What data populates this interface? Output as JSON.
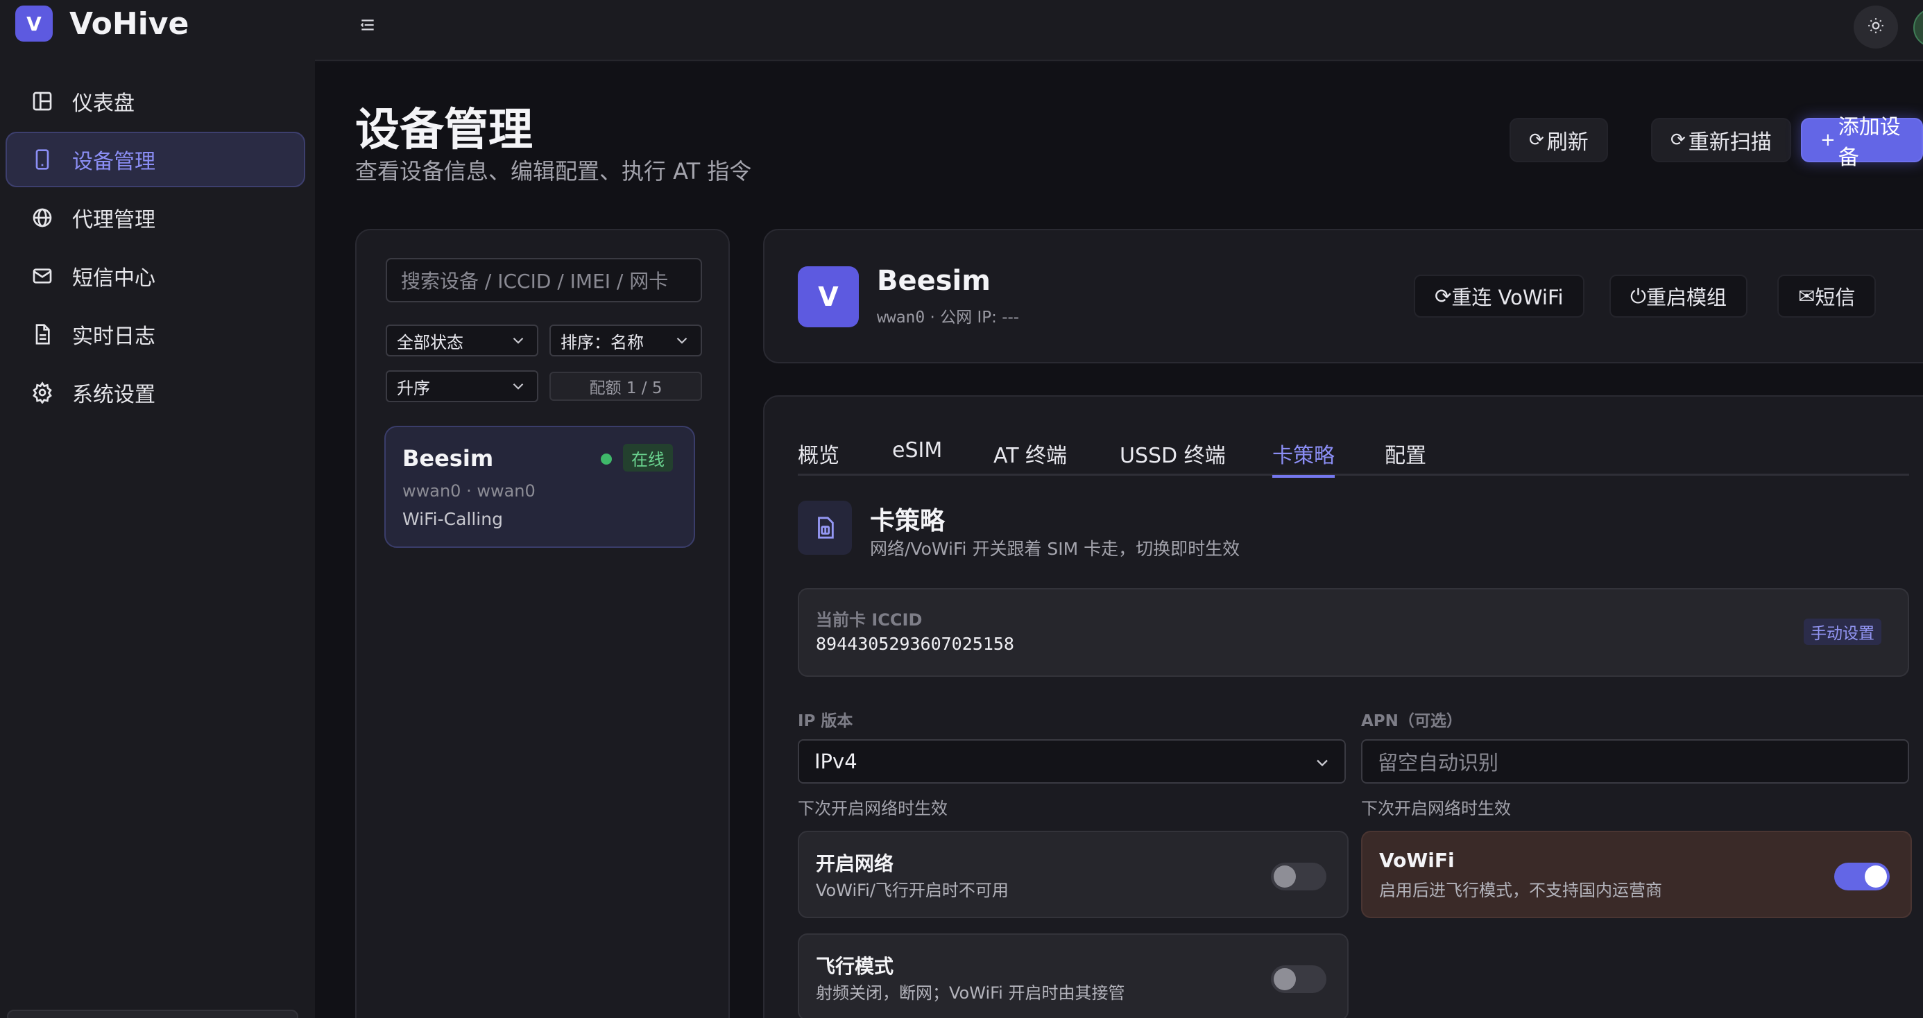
{
  "app": {
    "logo_letter": "V",
    "name": "VoHive"
  },
  "sidebar": {
    "items": [
      {
        "label": "仪表盘",
        "icon": "dashboard-icon"
      },
      {
        "label": "设备管理",
        "icon": "phone-icon",
        "active": true
      },
      {
        "label": "代理管理",
        "icon": "globe-icon"
      },
      {
        "label": "短信中心",
        "icon": "mail-icon"
      },
      {
        "label": "实时日志",
        "icon": "document-icon"
      },
      {
        "label": "系统设置",
        "icon": "gear-icon"
      }
    ]
  },
  "page": {
    "title": "设备管理",
    "subtitle": "查看设备信息、编辑配置、执行 AT 指令",
    "actions": {
      "refresh": "刷新",
      "rescan": "重新扫描",
      "add": "添加设备"
    }
  },
  "device_list": {
    "search_placeholder": "搜索设备 / ICCID / IMEI / 网卡",
    "status_filter": "全部状态",
    "sort": "排序：名称",
    "order": "升序",
    "quota": "配额 1 / 5",
    "devices": [
      {
        "name": "Beesim",
        "status": "在线",
        "meta": "wwan0 · wwan0",
        "type": "WiFi-Calling"
      }
    ]
  },
  "device_header": {
    "logo_letter": "V",
    "name": "Beesim",
    "iface": "wwan0",
    "ip_text": " · 公网 IP: ---",
    "actions": {
      "reconnect": "重连 VoWiFi",
      "restart": "重启模组",
      "sms": "短信"
    }
  },
  "tabs": [
    {
      "label": "概览"
    },
    {
      "label": "eSIM"
    },
    {
      "label": "AT 终端"
    },
    {
      "label": "USSD 终端"
    },
    {
      "label": "卡策略",
      "active": true
    },
    {
      "label": "配置"
    }
  ],
  "card_strategy": {
    "title": "卡策略",
    "subtitle": "网络/VoWiFi 开关跟着 SIM 卡走，切换即时生效",
    "iccid_label": "当前卡 ICCID",
    "iccid": "8944305293607025158",
    "manual_button": "手动设置",
    "ip_version": {
      "label": "IP 版本",
      "value": "IPv4",
      "hint": "下次开启网络时生效"
    },
    "apn": {
      "label": "APN（可选）",
      "placeholder": "留空自动识别",
      "hint": "下次开启网络时生效"
    },
    "toggles": {
      "network": {
        "title": "开启网络",
        "desc": "VoWiFi/飞行开启时不可用",
        "on": false
      },
      "vowifi": {
        "title": "VoWiFi",
        "desc": "启用后进飞行模式，不支持国内运营商",
        "on": true
      },
      "airplane": {
        "title": "飞行模式",
        "desc": "射频关闭，断网；VoWiFi 开启时由其接管",
        "on": false
      }
    }
  },
  "colors": {
    "accent": "#6366e6",
    "online": "#3fb86a",
    "bg": "#111116"
  }
}
